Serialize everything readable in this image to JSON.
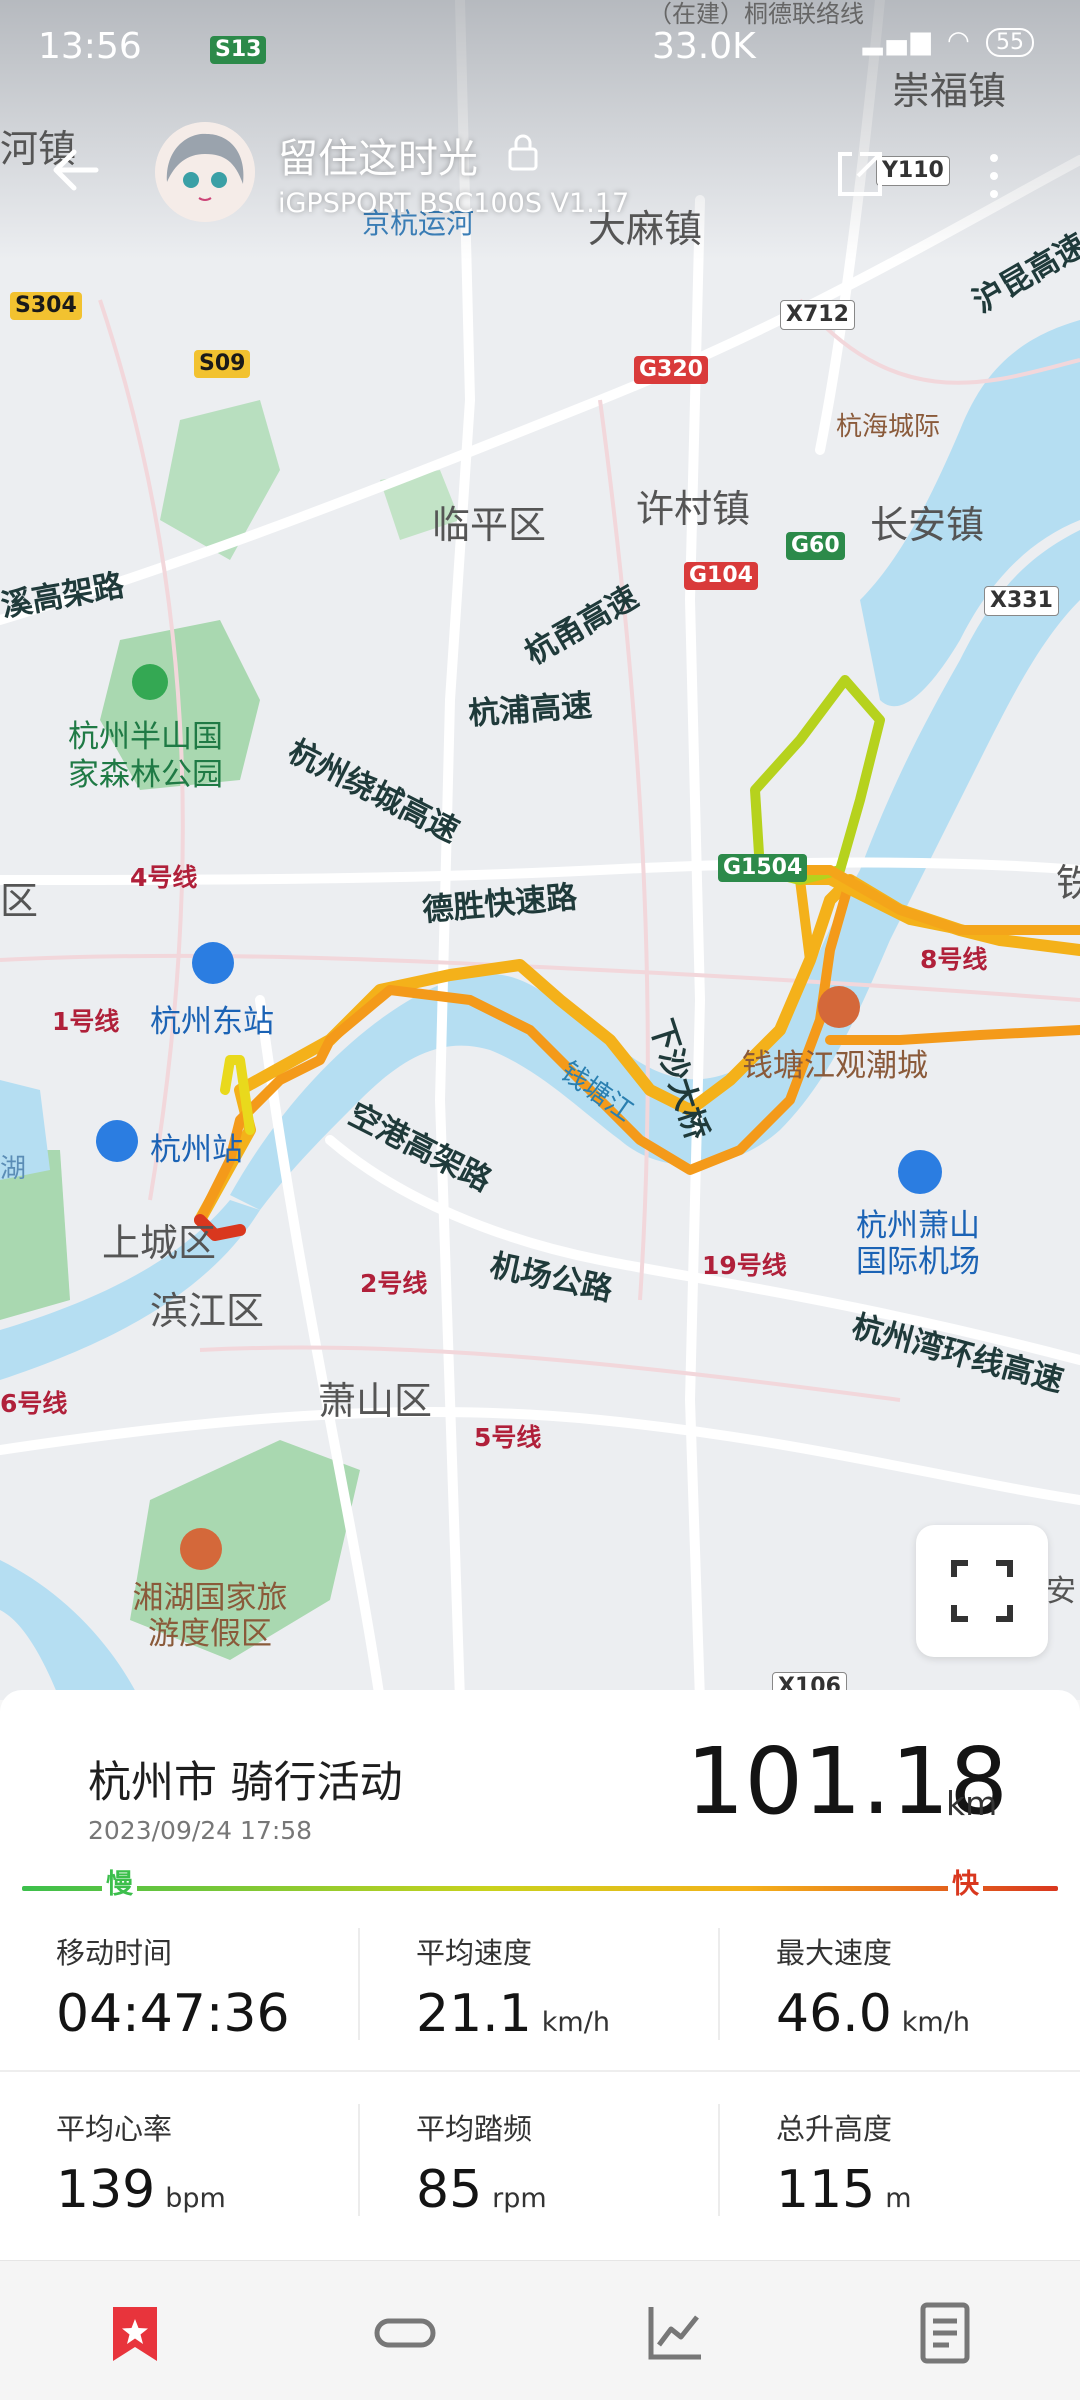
{
  "status": {
    "time": "13:56",
    "net_rate": "33.0K",
    "battery": "55"
  },
  "header": {
    "title": "留住这时光",
    "subtitle": "iGPSPORT BSC100S  V1.17"
  },
  "map_labels": {
    "places": [
      "崇福镇",
      "河镇",
      "大麻镇",
      "临平区",
      "许村镇",
      "长安镇",
      "杭海城际",
      "上城区",
      "滨江区",
      "萧山区",
      "铁",
      "安",
      "区",
      "湖",
      "京杭运河"
    ],
    "roads": [
      "沪昆高速",
      "杭甬高速",
      "杭浦高速",
      "杭州绕城高速",
      "德胜快速路",
      "空港高架路",
      "机场公路",
      "杭州湾环线高速",
      "溪高架路",
      "下沙大桥"
    ],
    "pois": [
      "杭州半山国家森林公园",
      "杭州东站",
      "杭州站",
      "钱塘江观潮城",
      "杭州萧山国际机场",
      "湘湖国家旅游度假区"
    ],
    "river": "钱塘江",
    "metro": [
      "4号线",
      "1号线",
      "8号线",
      "2号线",
      "19号线",
      "6号线",
      "5号线"
    ],
    "shields": [
      "S13",
      "S304",
      "S09",
      "G320",
      "X712",
      "Y110",
      "G60",
      "G104",
      "X331",
      "G1504",
      "X106"
    ],
    "under_construction": "（在建）桐德联络线"
  },
  "activity": {
    "title": "杭州市 骑行活动",
    "date": "2023/09/24 17:58",
    "distance": "101.18",
    "distance_unit": "km",
    "scale_slow": "慢",
    "scale_fast": "快",
    "stats": [
      {
        "label": "移动时间",
        "value": "04:47:36",
        "unit": ""
      },
      {
        "label": "平均速度",
        "value": "21.1",
        "unit": "km/h"
      },
      {
        "label": "最大速度",
        "value": "46.0",
        "unit": "km/h"
      },
      {
        "label": "平均心率",
        "value": "139",
        "unit": "bpm"
      },
      {
        "label": "平均踏频",
        "value": "85",
        "unit": "rpm"
      },
      {
        "label": "总升高度",
        "value": "115",
        "unit": "m"
      }
    ]
  },
  "nav": [
    "bookmark-icon",
    "link-icon",
    "chart-icon",
    "document-icon"
  ],
  "colors": {
    "slow": "#3cbf4c",
    "fast": "#d9371e",
    "accent": "#e8343c",
    "river": "#b5def2"
  }
}
